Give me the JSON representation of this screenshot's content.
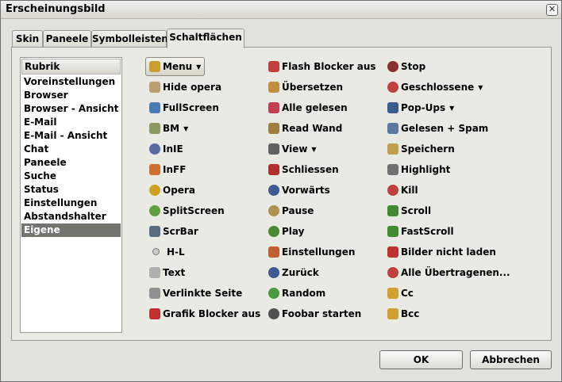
{
  "window": {
    "title": "Erscheinungsbild",
    "close_glyph": "✕"
  },
  "tabs": [
    {
      "label": "Skin",
      "active": false
    },
    {
      "label": "Paneele",
      "active": false
    },
    {
      "label": "Symbolleisten",
      "active": false
    },
    {
      "label": "Schaltflächen",
      "active": true
    }
  ],
  "category_list": {
    "header": "Rubrik",
    "items": [
      "Voreinstellungen",
      "Browser",
      "Browser - Ansicht",
      "E-Mail",
      "E-Mail - Ansicht",
      "Chat",
      "Paneele",
      "Suche",
      "Status",
      "Einstellungen",
      "Abstandshalter",
      "Eigene"
    ],
    "selected": "Eigene"
  },
  "buttons": {
    "col1": [
      {
        "label": "Menu",
        "icon": "menu-icon",
        "color": "#c8a030",
        "dropdown": true,
        "pressed": true
      },
      {
        "label": "Hide opera",
        "icon": "hide-icon",
        "color": "#b8a070",
        "dropdown": false
      },
      {
        "label": "FullScreen",
        "icon": "fullscreen-icon",
        "color": "#4a7ab0",
        "dropdown": false
      },
      {
        "label": "BM",
        "icon": "bookmark-icon",
        "color": "#8a9a60",
        "dropdown": true
      },
      {
        "label": "InIE",
        "icon": "ie-icon",
        "color": "#5a6aa0",
        "dropdown": false
      },
      {
        "label": "InFF",
        "icon": "firefox-icon",
        "color": "#d07030",
        "dropdown": false
      },
      {
        "label": "Opera",
        "icon": "opera-icon",
        "color": "#d0a020",
        "dropdown": false
      },
      {
        "label": "SplitScreen",
        "icon": "splitscreen-icon",
        "color": "#60a040",
        "dropdown": false
      },
      {
        "label": "ScrBar",
        "icon": "scrollbar-icon",
        "color": "#5a6a80",
        "dropdown": false
      },
      {
        "label": "H-L",
        "icon": "dot-icon",
        "color": "#a0a0a0",
        "dropdown": false
      },
      {
        "label": "Text",
        "icon": "text-icon",
        "color": "#b0b0b0",
        "dropdown": false
      },
      {
        "label": "Verlinkte Seite",
        "icon": "linked-page-icon",
        "color": "#909090",
        "dropdown": false
      },
      {
        "label": "Grafik Blocker aus",
        "icon": "image-blocker-icon",
        "color": "#c03030",
        "dropdown": false
      }
    ],
    "col2": [
      {
        "label": "Flash Blocker aus",
        "icon": "flash-blocker-icon",
        "color": "#c04040",
        "dropdown": false
      },
      {
        "label": "Übersetzen",
        "icon": "translate-icon",
        "color": "#c09040",
        "dropdown": false
      },
      {
        "label": "Alle gelesen",
        "icon": "all-read-icon",
        "color": "#c04050",
        "dropdown": false
      },
      {
        "label": "Read Wand",
        "icon": "wand-icon",
        "color": "#a08040",
        "dropdown": false
      },
      {
        "label": "View",
        "icon": "view-icon",
        "color": "#606060",
        "dropdown": true
      },
      {
        "label": "Schliessen",
        "icon": "close-tab-icon",
        "color": "#b03030",
        "dropdown": false
      },
      {
        "label": "Vorwärts",
        "icon": "forward-icon",
        "color": "#3a5a90",
        "dropdown": false
      },
      {
        "label": "Pause",
        "icon": "pause-icon",
        "color": "#b09050",
        "dropdown": false
      },
      {
        "label": "Play",
        "icon": "play-icon",
        "color": "#4a8a30",
        "dropdown": false
      },
      {
        "label": "Einstellungen",
        "icon": "settings-icon",
        "color": "#c06030",
        "dropdown": false
      },
      {
        "label": "Zurück",
        "icon": "back-icon",
        "color": "#3a5a90",
        "dropdown": false
      },
      {
        "label": "Random",
        "icon": "random-icon",
        "color": "#4a9a40",
        "dropdown": false
      },
      {
        "label": "Foobar starten",
        "icon": "foobar-icon",
        "color": "#505050",
        "dropdown": false
      }
    ],
    "col3": [
      {
        "label": "Stop",
        "icon": "stop-icon",
        "color": "#8a3030",
        "dropdown": false
      },
      {
        "label": "Geschlossene",
        "icon": "closed-tabs-icon",
        "color": "#c04040",
        "dropdown": true
      },
      {
        "label": "Pop-Ups",
        "icon": "popups-icon",
        "color": "#3a5a90",
        "dropdown": true
      },
      {
        "label": "Gelesen + Spam",
        "icon": "read-spam-icon",
        "color": "#5a7aa0",
        "dropdown": false
      },
      {
        "label": "Speichern",
        "icon": "save-icon",
        "color": "#c0a050",
        "dropdown": false
      },
      {
        "label": "Highlight",
        "icon": "magnifier-icon",
        "color": "#707070",
        "dropdown": false
      },
      {
        "label": "Kill",
        "icon": "kill-icon",
        "color": "#c04040",
        "dropdown": false
      },
      {
        "label": "Scroll",
        "icon": "scroll-icon",
        "color": "#408a30",
        "dropdown": false
      },
      {
        "label": "FastScroll",
        "icon": "fastscroll-icon",
        "color": "#408a30",
        "dropdown": false
      },
      {
        "label": "Bilder nicht laden",
        "icon": "no-images-icon",
        "color": "#c03030",
        "dropdown": false
      },
      {
        "label": "Alle Übertragenen...",
        "icon": "transfers-icon",
        "color": "#c04040",
        "dropdown": false
      },
      {
        "label": "Cc",
        "icon": "pencil-icon",
        "color": "#d0a030",
        "dropdown": false
      },
      {
        "label": "Bcc",
        "icon": "pencil-icon",
        "color": "#d0a030",
        "dropdown": false
      }
    ]
  },
  "dropdown_glyph": "▼",
  "footer": {
    "ok_label": "OK",
    "cancel_label": "Abbrechen"
  }
}
